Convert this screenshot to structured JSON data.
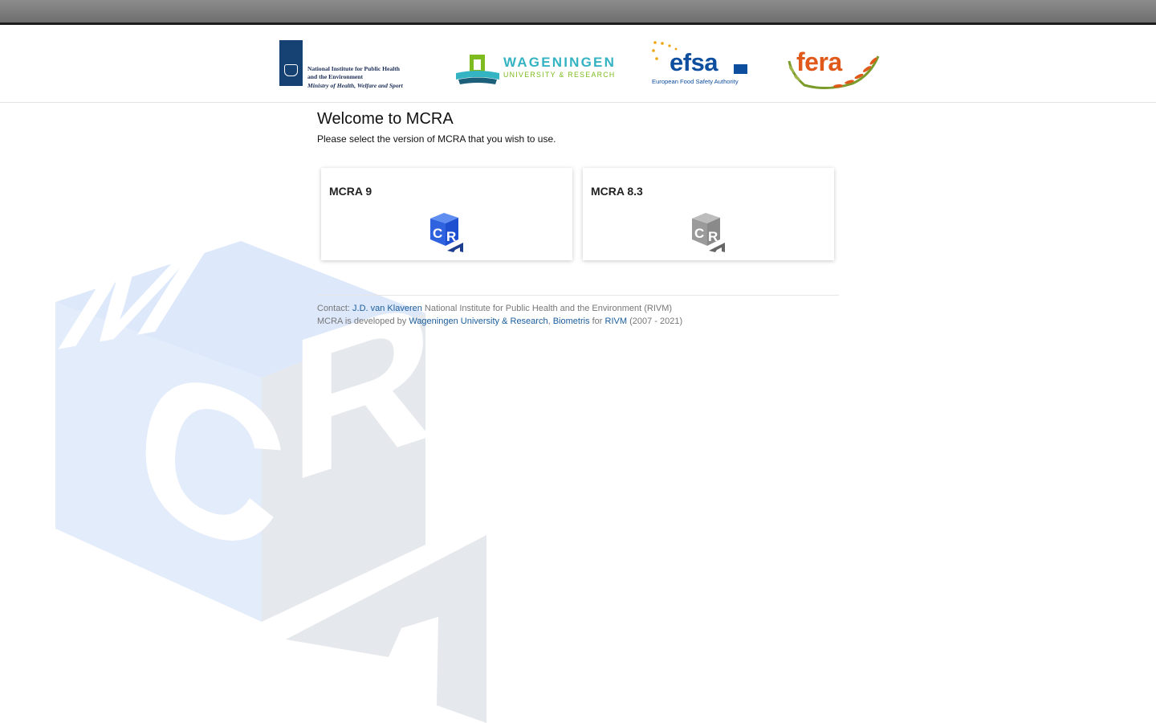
{
  "logos": {
    "rivm": {
      "line1": "National Institute for Public Health",
      "line2": "and the Environment",
      "line3": "Ministry of Health, Welfare and Sport"
    },
    "wageningen": {
      "name": "WAGENINGEN",
      "sub": "UNIVERSITY & RESEARCH"
    },
    "efsa": {
      "name": "efsa",
      "sub": "European Food Safety Authority"
    },
    "fera": {
      "name": "fera"
    }
  },
  "main": {
    "title": "Welcome to MCRA",
    "subtitle": "Please select the version of MCRA that you wish to use."
  },
  "versions": [
    {
      "label": "MCRA 9",
      "icon": "mcra-cube-icon-blue",
      "color": "#1f4fd1"
    },
    {
      "label": "MCRA 8.3",
      "icon": "mcra-cube-icon-gray",
      "color": "#8a8a8a"
    }
  ],
  "footer": {
    "contact_prefix": "Contact:",
    "contact_name": "J.D. van Klaveren",
    "contact_org": "National Institute for Public Health and the Environment (RIVM)",
    "dev_prefix": "MCRA is developed by",
    "dev_wur": "Wageningen University & Research",
    "dev_sep": ",",
    "dev_biometris": "Biometris",
    "dev_for": "for",
    "dev_rivm": "RIVM",
    "dev_years": "(2007 - 2021)"
  },
  "colors": {
    "link": "#1a5d9c",
    "topbar": "#7d7d7d",
    "watermark": "#e3ecfb"
  }
}
